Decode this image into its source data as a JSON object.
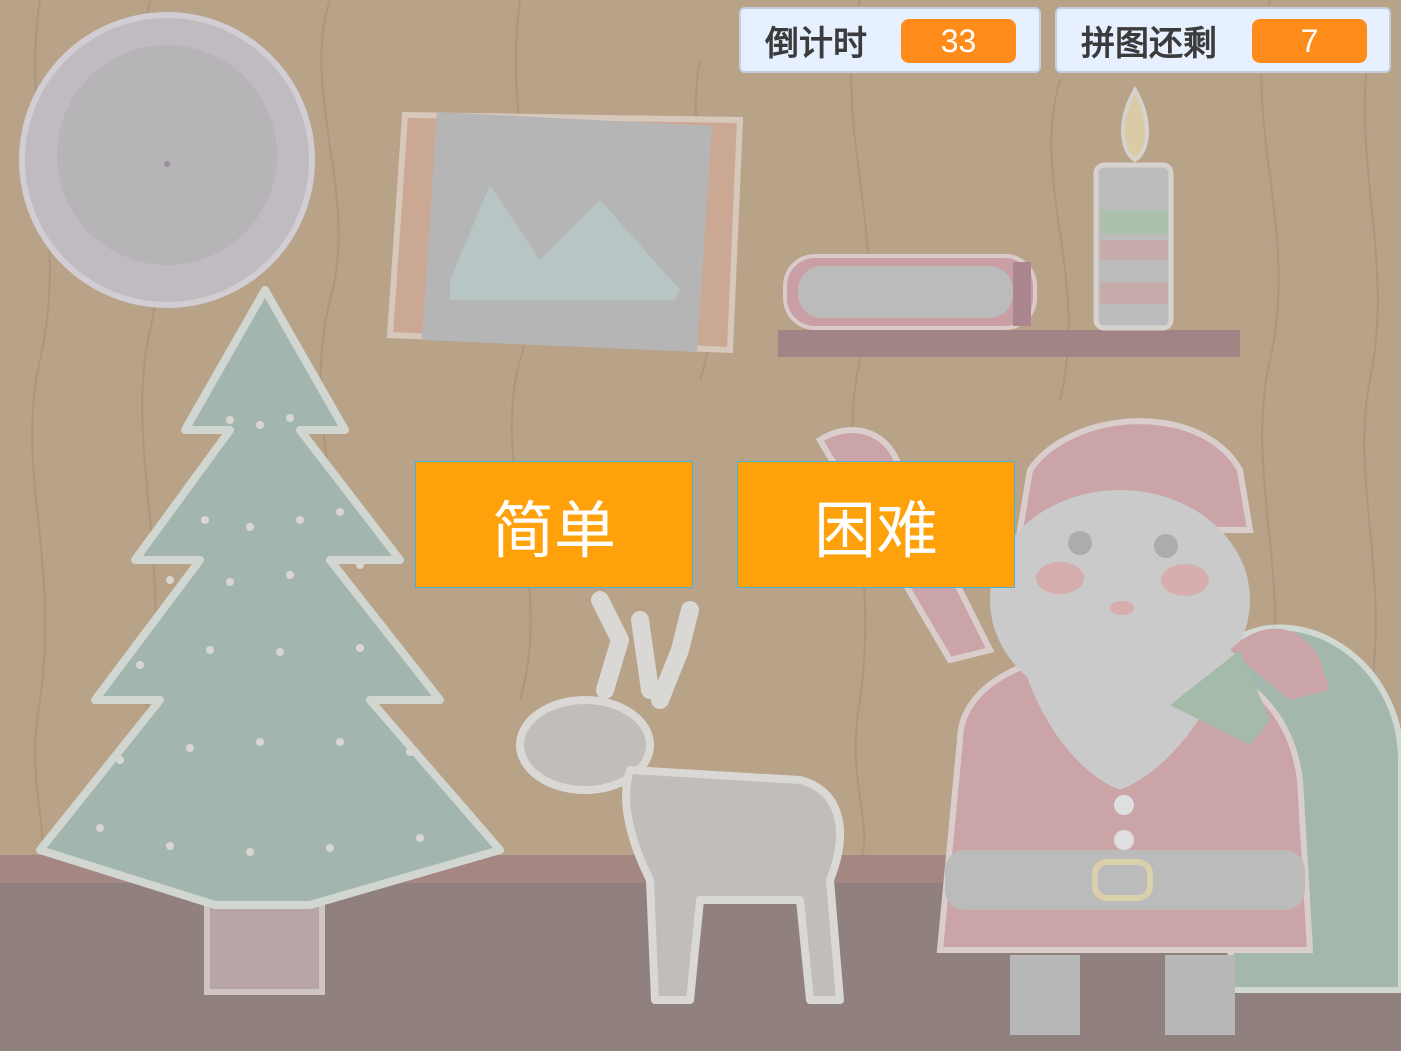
{
  "hud": {
    "countdown": {
      "label": "倒计时",
      "value": "33"
    },
    "pieces_left": {
      "label": "拼图还剩",
      "value": "7"
    }
  },
  "menu": {
    "easy_label": "简单",
    "hard_label": "困难"
  },
  "colors": {
    "wall": "#b59e82",
    "floor": "#8b7a78",
    "button": "#ffa10a",
    "monitor_value": "#ff8c1a",
    "monitor_bg": "#e6f0ff"
  }
}
